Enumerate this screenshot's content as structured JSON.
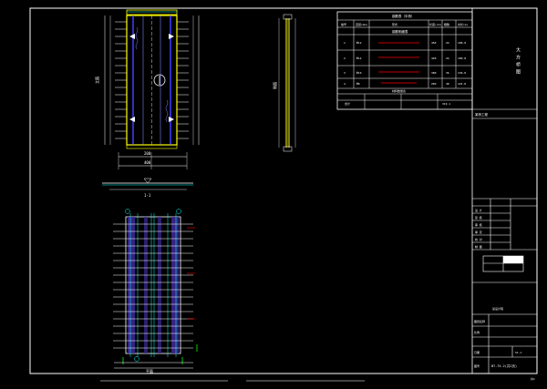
{
  "title_block": {
    "vertical_title": "大 方 桥 图",
    "project_label": "某桥工程",
    "rows": [
      "设 计",
      "复 核",
      "审 核",
      "审 定",
      "校 对",
      "制 图"
    ],
    "unit": "某设计院",
    "drawing_name": "图纸名称",
    "scale_label": "比例",
    "drawing_no_label": "图号",
    "drawing_no": "B7-T4-2(共2页)",
    "date_label": "日期",
    "sheet_label": "S1-1",
    "page_no": "共1"
  },
  "table": {
    "title": "钢筋表（半桥）",
    "sub_title": "钢筋明细表",
    "bottom_title": "材料数量表",
    "header": [
      "编号",
      "直径(mm)",
      "形式",
      "长度(cm)",
      "根数",
      "共长(m)",
      "重量(kg)"
    ],
    "rows": [
      [
        "1",
        "Φ12",
        "",
        "450",
        "24",
        "108.0",
        "95.9"
      ],
      [
        "2",
        "Φ12",
        "",
        "420",
        "24",
        "100.8",
        "89.5"
      ],
      [
        "3",
        "Φ10",
        "",
        "380",
        "36",
        "136.8",
        "84.4"
      ],
      [
        "4",
        "Φ8",
        "",
        "260",
        "48",
        "124.8",
        "49.3"
      ]
    ],
    "total_label": "合计",
    "total_value": "319.1"
  },
  "labels": {
    "elevation": "立面",
    "section": "1-1",
    "plan": "平面",
    "dim_total": "400",
    "dim_half": "200",
    "side_view": "侧面"
  },
  "colors": {
    "line_white": "#ffffff",
    "line_yellow": "#ffff00",
    "line_cyan": "#00ffff",
    "line_purple": "#8080ff",
    "line_red": "#ff0000",
    "line_green": "#00ff00",
    "line_blue": "#4040ff",
    "background": "#000000"
  }
}
